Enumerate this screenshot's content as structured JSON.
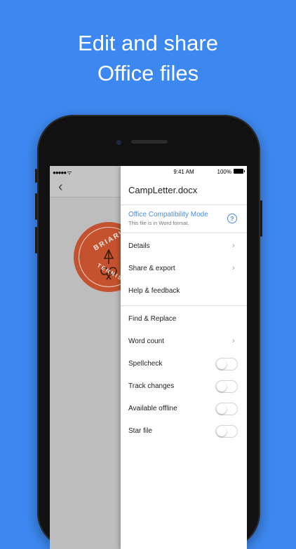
{
  "headline": {
    "line1": "Edit and share",
    "line2": "Office files"
  },
  "status": {
    "time": "9:41 AM",
    "battery": "100%",
    "signal": "●●●●● ᯤ"
  },
  "doc": {
    "back_icon": "chevron-left-icon",
    "logo_text_top": "BRIARW",
    "logo_text_bottom": "TENNIS CA"
  },
  "panel": {
    "title": "CampLetter.docx",
    "compat": {
      "title": "Office Compatibility Mode",
      "subtitle": "This file is in Word format.",
      "icon": "help-circle-icon"
    },
    "items": [
      {
        "label": "Details",
        "control": "chevron"
      },
      {
        "label": "Share & export",
        "control": "chevron"
      },
      {
        "label": "Help & feedback",
        "control": "none"
      },
      {
        "label": "Find & Replace",
        "control": "none"
      },
      {
        "label": "Word count",
        "control": "chevron"
      },
      {
        "label": "Spellcheck",
        "control": "toggle",
        "on": false
      },
      {
        "label": "Track changes",
        "control": "toggle",
        "on": false
      },
      {
        "label": "Available offline",
        "control": "toggle",
        "on": false
      },
      {
        "label": "Star file",
        "control": "toggle",
        "on": false
      }
    ]
  },
  "colors": {
    "background": "#3d88f0",
    "accent": "#4a8de0",
    "logo": "#c4522e"
  }
}
